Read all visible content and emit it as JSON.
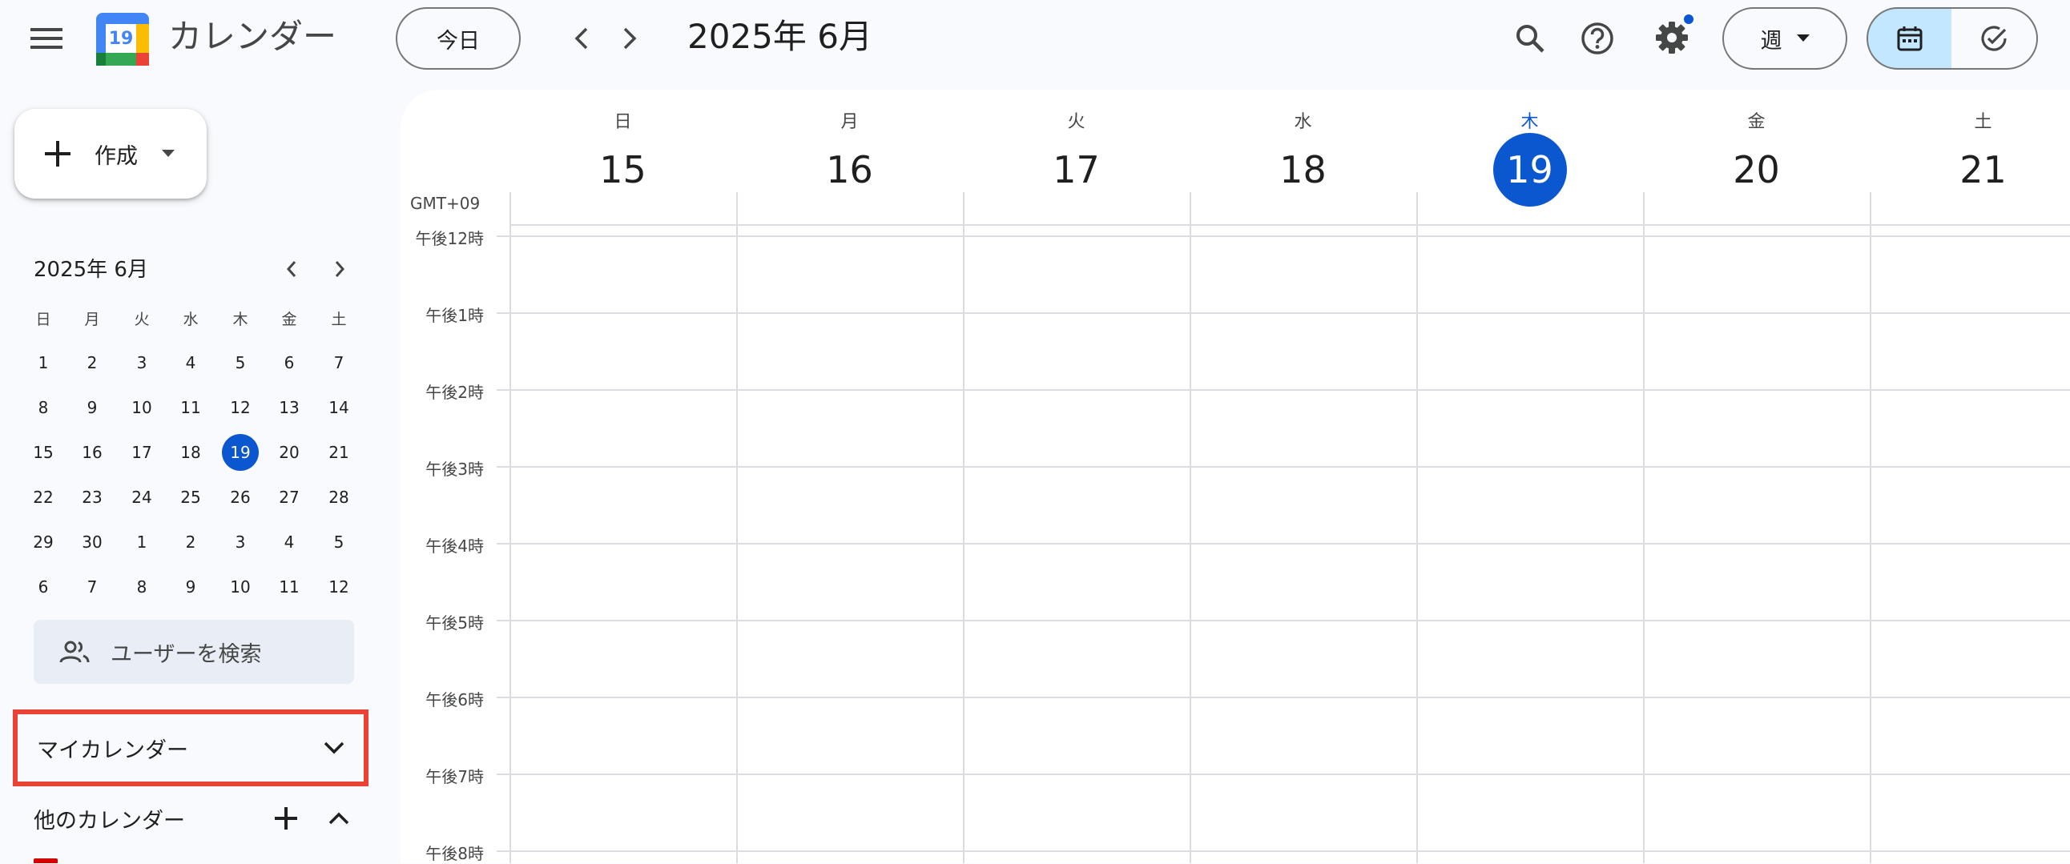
{
  "header": {
    "app_title": "カレンダー",
    "logo_day": "19",
    "today_label": "今日",
    "period_title": "2025年 6月",
    "view_label": "週",
    "colors": {
      "accent": "#0b57d0",
      "highlight": "#ea4335"
    }
  },
  "sidebar": {
    "create_label": "作成",
    "mini_calendar": {
      "title": "2025年 6月",
      "weekday_headers": [
        "日",
        "月",
        "火",
        "水",
        "木",
        "金",
        "土"
      ],
      "weeks": [
        [
          "1",
          "2",
          "3",
          "4",
          "5",
          "6",
          "7"
        ],
        [
          "8",
          "9",
          "10",
          "11",
          "12",
          "13",
          "14"
        ],
        [
          "15",
          "16",
          "17",
          "18",
          "19",
          "20",
          "21"
        ],
        [
          "22",
          "23",
          "24",
          "25",
          "26",
          "27",
          "28"
        ],
        [
          "29",
          "30",
          "1",
          "2",
          "3",
          "4",
          "5"
        ],
        [
          "6",
          "7",
          "8",
          "9",
          "10",
          "11",
          "12"
        ]
      ],
      "today": "19"
    },
    "search_people_label": "ユーザーを検索",
    "my_calendars_label": "マイカレンダー",
    "other_calendars_label": "他のカレンダー"
  },
  "week": {
    "timezone_label": "GMT+09",
    "days": [
      {
        "dow": "日",
        "date": "15",
        "today": false
      },
      {
        "dow": "月",
        "date": "16",
        "today": false
      },
      {
        "dow": "火",
        "date": "17",
        "today": false
      },
      {
        "dow": "水",
        "date": "18",
        "today": false
      },
      {
        "dow": "木",
        "date": "19",
        "today": true
      },
      {
        "dow": "金",
        "date": "20",
        "today": false
      },
      {
        "dow": "土",
        "date": "21",
        "today": false
      }
    ],
    "time_labels": [
      "午後12時",
      "午後1時",
      "午後2時",
      "午後3時",
      "午後4時",
      "午後5時",
      "午後6時",
      "午後7時",
      "午後8時"
    ]
  }
}
